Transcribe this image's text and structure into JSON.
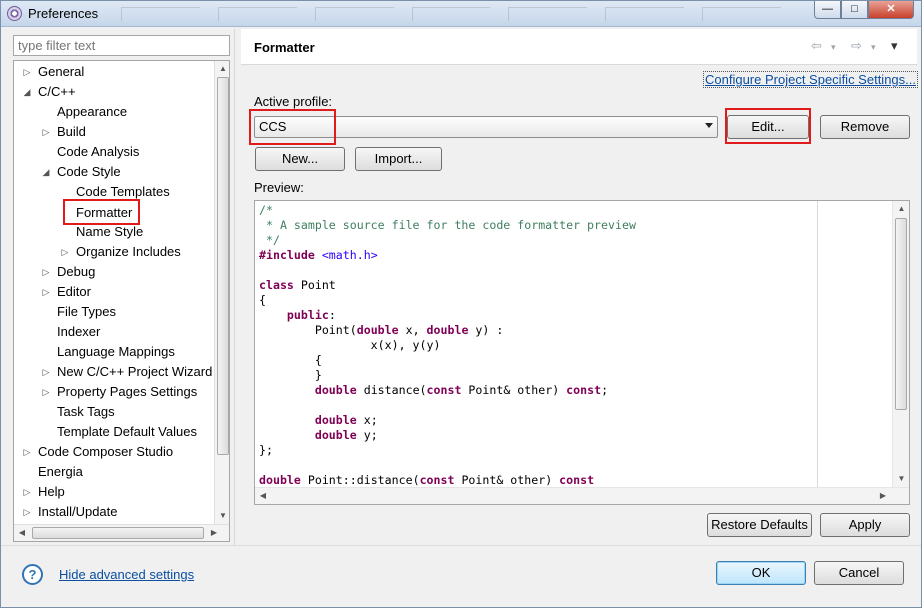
{
  "window": {
    "title": "Preferences",
    "min_glyph": "—",
    "max_glyph": "□",
    "close_glyph": "✕"
  },
  "filter": {
    "placeholder": "type filter text"
  },
  "tree": [
    {
      "label": "General",
      "level": 0,
      "arrow": "▷"
    },
    {
      "label": "C/C++",
      "level": 0,
      "arrow": "◢"
    },
    {
      "label": "Appearance",
      "level": 1,
      "arrow": ""
    },
    {
      "label": "Build",
      "level": 1,
      "arrow": "▷"
    },
    {
      "label": "Code Analysis",
      "level": 1,
      "arrow": ""
    },
    {
      "label": "Code Style",
      "level": 1,
      "arrow": "◢"
    },
    {
      "label": "Code Templates",
      "level": 2,
      "arrow": ""
    },
    {
      "label": "Formatter",
      "level": 2,
      "arrow": "",
      "selected": true
    },
    {
      "label": "Name Style",
      "level": 2,
      "arrow": ""
    },
    {
      "label": "Organize Includes",
      "level": 2,
      "arrow": "▷"
    },
    {
      "label": "Debug",
      "level": 1,
      "arrow": "▷"
    },
    {
      "label": "Editor",
      "level": 1,
      "arrow": "▷"
    },
    {
      "label": "File Types",
      "level": 1,
      "arrow": ""
    },
    {
      "label": "Indexer",
      "level": 1,
      "arrow": ""
    },
    {
      "label": "Language Mappings",
      "level": 1,
      "arrow": ""
    },
    {
      "label": "New C/C++ Project Wizard",
      "level": 1,
      "arrow": "▷"
    },
    {
      "label": "Property Pages Settings",
      "level": 1,
      "arrow": "▷"
    },
    {
      "label": "Task Tags",
      "level": 1,
      "arrow": ""
    },
    {
      "label": "Template Default Values",
      "level": 1,
      "arrow": ""
    },
    {
      "label": "Code Composer Studio",
      "level": 0,
      "arrow": "▷"
    },
    {
      "label": "Energia",
      "level": 0,
      "arrow": ""
    },
    {
      "label": "Help",
      "level": 0,
      "arrow": "▷"
    },
    {
      "label": "Install/Update",
      "level": 0,
      "arrow": "▷"
    }
  ],
  "page": {
    "title": "Formatter",
    "back_icon": "⇦",
    "forward_icon": "⇨",
    "menu_icon": "▾",
    "config_link": "Configure Project Specific Settings...",
    "active_profile_label": "Active profile:",
    "profile_value": "CCS",
    "edit_label": "Edit...",
    "remove_label": "Remove",
    "new_label": "New...",
    "import_label": "Import...",
    "preview_label": "Preview:"
  },
  "preview_code": [
    [
      [
        "cm",
        "/*"
      ]
    ],
    [
      [
        "cm",
        " * A sample source file for the code formatter preview"
      ]
    ],
    [
      [
        "cm",
        " */"
      ]
    ],
    [
      [
        "pp",
        "#include"
      ],
      [
        "",
        " "
      ],
      [
        "inc",
        "<math.h>"
      ]
    ],
    [],
    [
      [
        "kw",
        "class"
      ],
      [
        "",
        " Point"
      ]
    ],
    [
      [
        "",
        "{"
      ]
    ],
    [
      [
        "",
        "    "
      ],
      [
        "kw",
        "public"
      ],
      [
        "",
        ":"
      ]
    ],
    [
      [
        "",
        "        Point("
      ],
      [
        "kw",
        "double"
      ],
      [
        "",
        " x, "
      ],
      [
        "kw",
        "double"
      ],
      [
        "",
        " y) :"
      ]
    ],
    [
      [
        "",
        "                x(x), y(y)"
      ]
    ],
    [
      [
        "",
        "        {"
      ]
    ],
    [
      [
        "",
        "        }"
      ]
    ],
    [
      [
        "",
        "        "
      ],
      [
        "kw",
        "double"
      ],
      [
        "",
        " distance("
      ],
      [
        "kw",
        "const"
      ],
      [
        "",
        " Point& other) "
      ],
      [
        "kw",
        "const"
      ],
      [
        "",
        ";"
      ]
    ],
    [],
    [
      [
        "",
        "        "
      ],
      [
        "kw",
        "double"
      ],
      [
        "",
        " x;"
      ]
    ],
    [
      [
        "",
        "        "
      ],
      [
        "kw",
        "double"
      ],
      [
        "",
        " y;"
      ]
    ],
    [
      [
        "",
        "};"
      ]
    ],
    [],
    [
      [
        "kw",
        "double"
      ],
      [
        "",
        " Point::distance("
      ],
      [
        "kw",
        "const"
      ],
      [
        "",
        " Point& other) "
      ],
      [
        "kw",
        "const"
      ]
    ]
  ],
  "footer": {
    "restore_defaults_label": "Restore Defaults",
    "apply_label": "Apply",
    "help_icon": "?",
    "hide_advanced_label": "Hide advanced settings",
    "ok_label": "OK",
    "cancel_label": "Cancel"
  },
  "colors": {
    "highlight": "#e01b1b",
    "link": "#0b4ea2",
    "selected_item_border": "#e01b1b"
  }
}
